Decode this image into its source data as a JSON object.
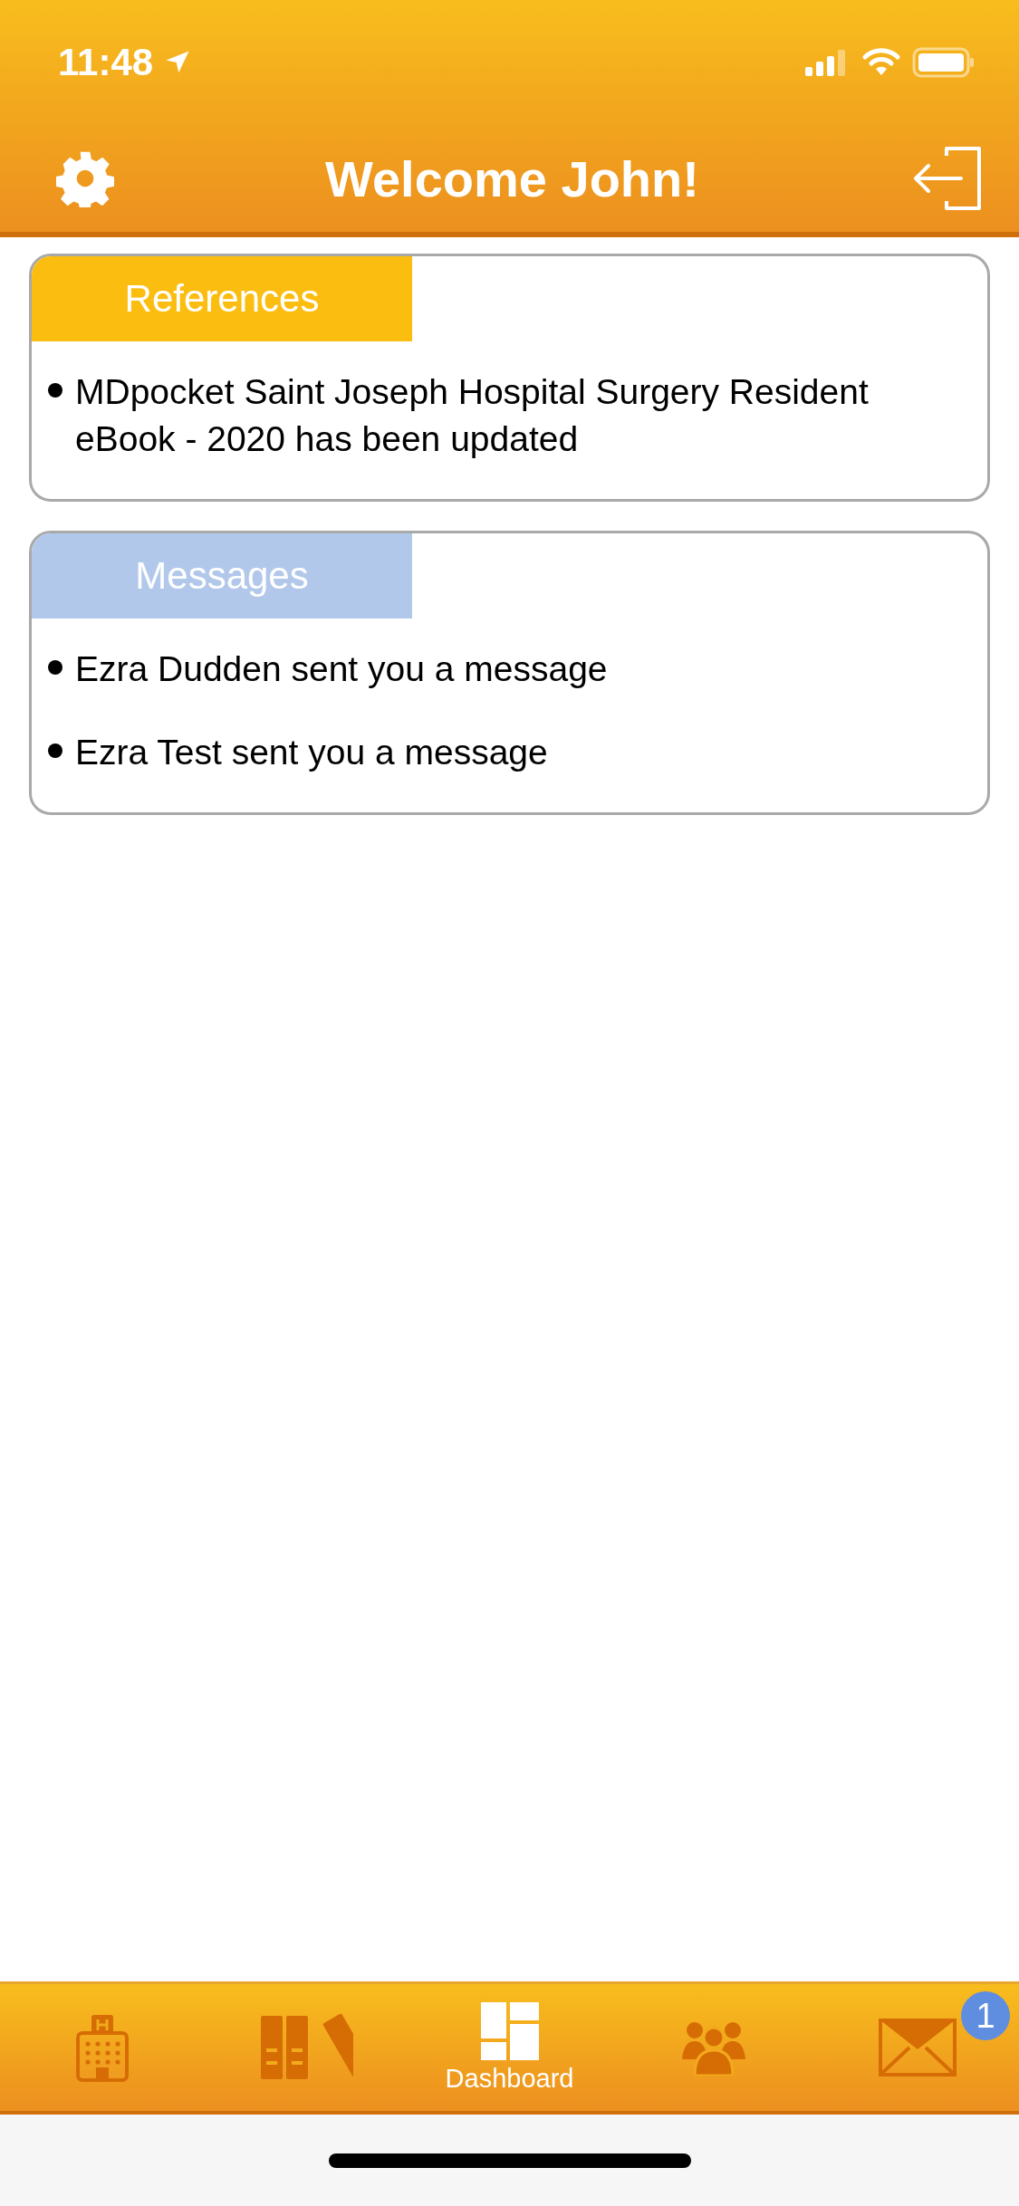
{
  "status_bar": {
    "time": "11:48"
  },
  "header": {
    "title": "Welcome John!"
  },
  "cards": [
    {
      "title": "References",
      "color": "#fbbd0f",
      "items": [
        "MDpocket Saint Joseph Hospital Surgery Resident eBook - 2020 has been updated"
      ]
    },
    {
      "title": "Messages",
      "color": "#b2c8eb",
      "items": [
        "Ezra Dudden sent you a message",
        "Ezra Test sent you a message"
      ]
    }
  ],
  "tab_bar": [
    {
      "kind": "hospital",
      "selected": false
    },
    {
      "kind": "books",
      "selected": false
    },
    {
      "kind": "dashboard",
      "label": "Dashboard",
      "selected": true
    },
    {
      "kind": "group",
      "selected": false
    },
    {
      "kind": "mail",
      "selected": false,
      "badge": "1"
    }
  ]
}
